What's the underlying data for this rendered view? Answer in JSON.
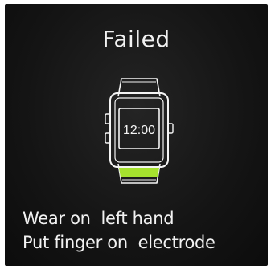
{
  "status": {
    "title": "Failed"
  },
  "watch_illustration": {
    "time": "12:00",
    "icon": "smartwatch-icon",
    "accent_color": "#a6e22e"
  },
  "instructions": {
    "line1": "Wear on  left hand",
    "line2": "Put finger on  electrode"
  }
}
